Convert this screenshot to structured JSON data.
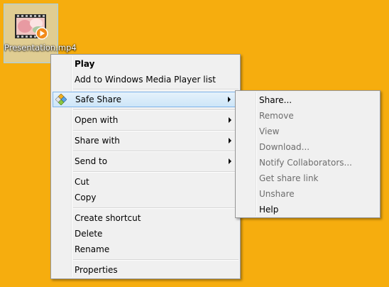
{
  "desktop": {
    "file_label": "Presentation.mp4",
    "file_icon": "video-file-icon"
  },
  "context_menu": {
    "items": {
      "play": {
        "label": "Play"
      },
      "add_to_wmp": {
        "label": "Add to Windows Media Player list"
      },
      "safe_share": {
        "label": "Safe Share",
        "icon": "safe-share-icon"
      },
      "open_with": {
        "label": "Open with"
      },
      "share_with": {
        "label": "Share with"
      },
      "send_to": {
        "label": "Send to"
      },
      "cut": {
        "label": "Cut"
      },
      "copy": {
        "label": "Copy"
      },
      "create_shortcut": {
        "label": "Create shortcut"
      },
      "delete": {
        "label": "Delete"
      },
      "rename": {
        "label": "Rename"
      },
      "properties": {
        "label": "Properties"
      }
    }
  },
  "submenu": {
    "items": {
      "share": {
        "label": "Share..."
      },
      "remove": {
        "label": "Remove"
      },
      "view": {
        "label": "View"
      },
      "download": {
        "label": "Download..."
      },
      "notify": {
        "label": "Notify Collaborators..."
      },
      "get_link": {
        "label": "Get share link"
      },
      "unshare": {
        "label": "Unshare"
      },
      "help": {
        "label": "Help"
      }
    }
  },
  "colors": {
    "desktop_background": "#f6ad0e",
    "menu_background": "#f0f0f0",
    "hover_border": "#7eb4ea",
    "disabled_text": "#6d6d6d"
  }
}
